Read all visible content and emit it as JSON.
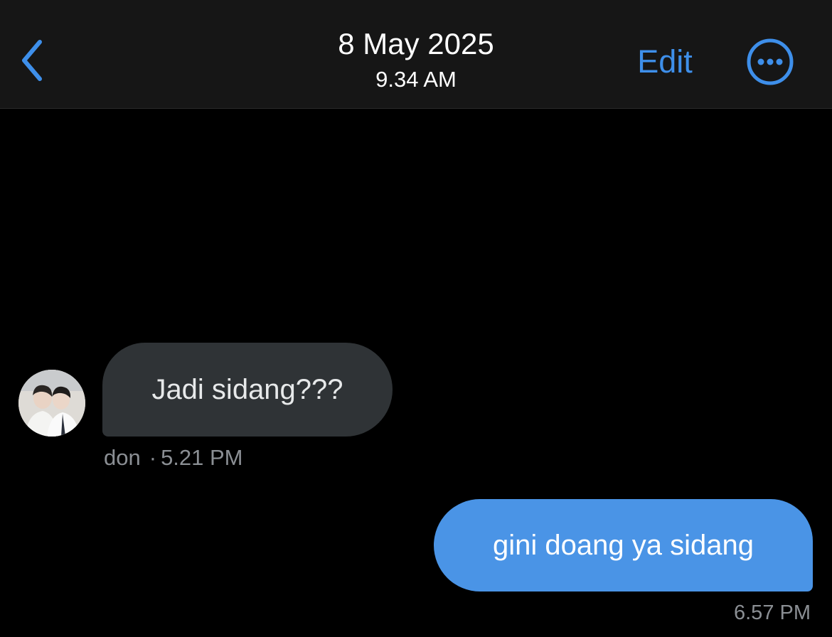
{
  "header": {
    "date": "8 May 2025",
    "time": "9.34 AM",
    "edit_label": "Edit",
    "back_icon": "chevron-left-icon",
    "more_icon": "more-options-icon",
    "accent_color": "#3e8fea",
    "background_color": "#161616"
  },
  "messages": [
    {
      "direction": "incoming",
      "text": "Jadi sidang???",
      "sender": "don",
      "separator": "·",
      "time": "5.21 PM",
      "bubble_color": "#2f3336"
    },
    {
      "direction": "outgoing",
      "text": "gini doang ya sidang",
      "time": "6.57 PM",
      "bubble_color": "#4a94e6"
    }
  ]
}
